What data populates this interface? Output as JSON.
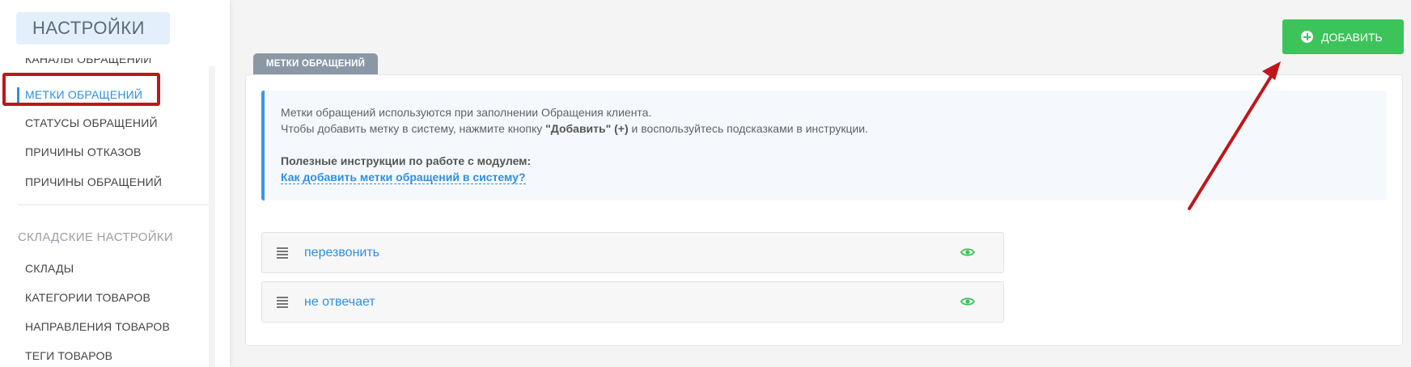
{
  "sidebar": {
    "title": "НАСТРОЙКИ",
    "items": [
      {
        "label": "КАНАЛЫ ОБРАЩЕНИЙ"
      },
      {
        "label": "МЕТКИ ОБРАЩЕНИЙ",
        "active": true
      },
      {
        "label": "СТАТУСЫ ОБРАЩЕНИЙ"
      },
      {
        "label": "ПРИЧИНЫ ОТКАЗОВ"
      },
      {
        "label": "ПРИЧИНЫ ОБРАЩЕНИЙ"
      }
    ],
    "group_title": "СКЛАДСКИЕ НАСТРОЙКИ",
    "group_items": [
      {
        "label": "СКЛАДЫ"
      },
      {
        "label": "КАТЕГОРИИ ТОВАРОВ"
      },
      {
        "label": "НАПРАВЛЕНИЯ ТОВАРОВ"
      },
      {
        "label": "ТЕГИ ТОВАРОВ"
      }
    ]
  },
  "main": {
    "tab_label": "МЕТКИ ОБРАЩЕНИЙ",
    "add_button_label": "ДОБАВИТЬ",
    "info": {
      "line1": "Метки обращений используются при заполнении Обращения клиента.",
      "line2_prefix": "Чтобы добавить метку в систему, нажмите кнопку ",
      "line2_bold": "\"Добавить\" (+)",
      "line2_suffix": " и воспользуйтесь подсказками в инструкции.",
      "instructions_title": "Полезные инструкции по работе с модулем:",
      "instructions_link": "Как добавить метки обращений в систему?"
    },
    "tags": [
      {
        "label": "перезвонить",
        "icon": "eye-icon"
      },
      {
        "label": "не отвечает",
        "icon": "eye-icon"
      }
    ]
  },
  "colors": {
    "accent_blue": "#2f8fe0",
    "add_button_green": "#3cc35a",
    "annotation_red": "#c0161a",
    "eye_green": "#3cc35a"
  }
}
